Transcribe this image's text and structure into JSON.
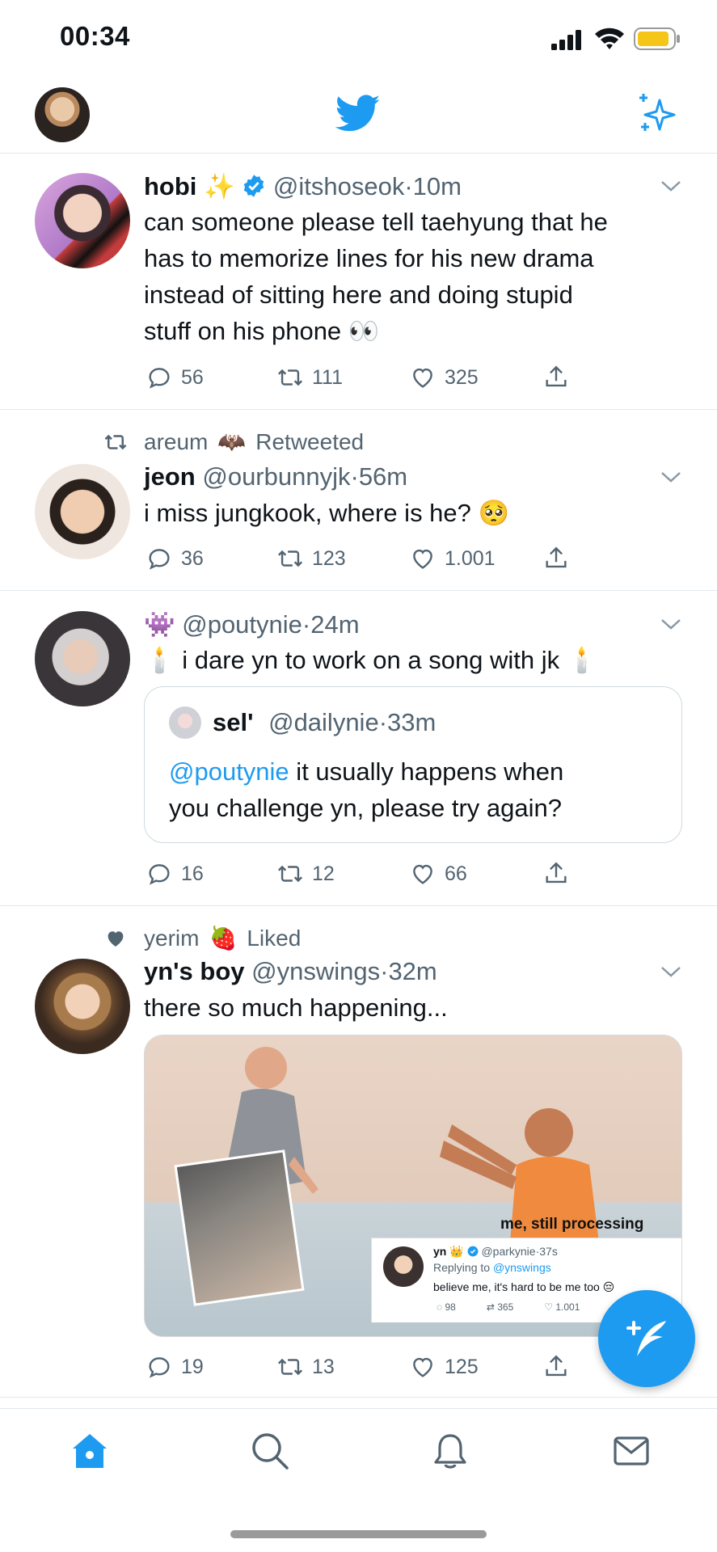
{
  "status_bar": {
    "time": "00:34"
  },
  "colors": {
    "accent": "#1d9bf0",
    "text": "#0f1419",
    "muted": "#536471",
    "divider": "#e1e8ed"
  },
  "icons": {
    "topbar": [
      "profile-avatar",
      "twitter-bird-icon",
      "sparkle-icon"
    ],
    "actions": [
      "reply-icon",
      "retweet-icon",
      "like-icon",
      "share-icon"
    ],
    "nav": [
      "home-icon",
      "search-icon",
      "notifications-icon",
      "messages-icon"
    ],
    "fab": "compose-tweet-icon"
  },
  "tweets": [
    {
      "name": "hobi",
      "name_emoji": "✨",
      "verified": true,
      "handle": "@itshoseok",
      "time": "10m",
      "text_lines": [
        "can someone please tell taehyung that he",
        "has to memorize lines for his new drama",
        "instead of sitting here and doing stupid",
        "stuff on his phone 👀"
      ],
      "replies": "56",
      "retweets": "111",
      "likes": "325"
    },
    {
      "context_user": "areum",
      "context_emoji": "🦇",
      "context_action": "Retweeted",
      "name": "jeon",
      "handle": "@ourbunnyjk",
      "time": "56m",
      "text": "i miss jungkook, where is he? 🥺",
      "replies": "36",
      "retweets": "123",
      "likes": "1.001"
    },
    {
      "name_emoji": "👾",
      "handle": "@poutynie",
      "time": "24m",
      "text": "🕯️ i dare yn to work on a song with jk 🕯️",
      "quote": {
        "name": "sel'",
        "handle": "@dailynie",
        "time": "33m",
        "mention": "@poutynie",
        "text_after_mention": " it usually happens when",
        "text_line2": "you challenge yn, please try again?"
      },
      "replies": "16",
      "retweets": "12",
      "likes": "66"
    },
    {
      "context_user": "yerim",
      "context_emoji": "🍓",
      "context_action": "Liked",
      "name": "yn's boy",
      "handle": "@ynswings",
      "time": "32m",
      "text": "there so much happening...",
      "media": {
        "caption": "me, still processing",
        "embedded_tweet": {
          "name": "yn",
          "name_emoji": "👑",
          "handle": "@parkynie",
          "time": "37s",
          "replying_prefix": "Replying to ",
          "replying_to": "@ynswings",
          "text": "believe me, it's hard to be me too 😔",
          "replies": "98",
          "retweets": "365",
          "likes": "1.001"
        }
      },
      "replies": "19",
      "retweets": "13",
      "likes": "125"
    }
  ]
}
